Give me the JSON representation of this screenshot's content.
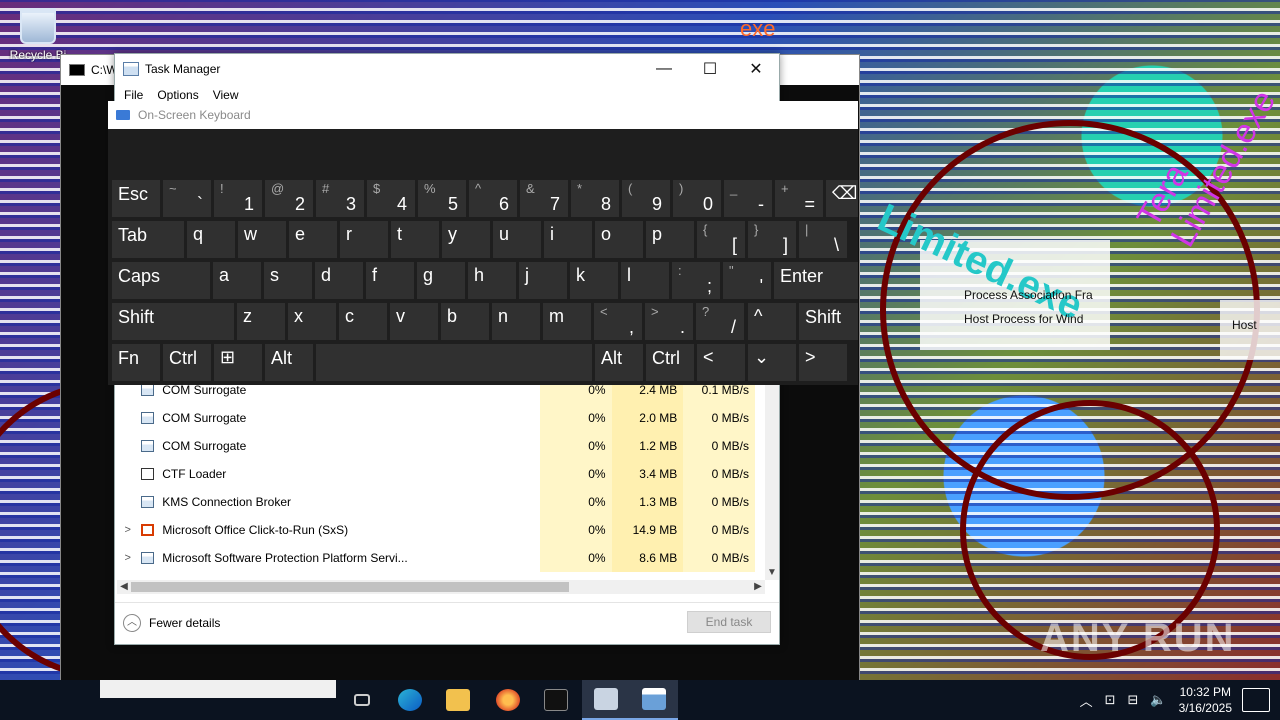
{
  "desktop": {
    "recycle_bin_label": "Recycle Bi",
    "background_texts": [
      "Tera Limited.exe",
      "exe",
      "Limited.exe",
      "Host Process for Wind",
      "Process Association Fra",
      "Host"
    ]
  },
  "terminal": {
    "title_fragment": "C:\\W",
    "partial_text": "Process for Wind"
  },
  "task_manager": {
    "title": "Task Manager",
    "menu": [
      "File",
      "Options",
      "View"
    ],
    "controls": {
      "minimize": "—",
      "maximize": "☐",
      "close": "✕"
    },
    "processes": [
      {
        "expand": "",
        "name": "COM Surrogate",
        "cpu": "0%",
        "memory": "2.4 MB",
        "disk": "0.1 MB/s"
      },
      {
        "expand": "",
        "name": "COM Surrogate",
        "cpu": "0%",
        "memory": "2.0 MB",
        "disk": "0 MB/s"
      },
      {
        "expand": "",
        "name": "COM Surrogate",
        "cpu": "0%",
        "memory": "1.2 MB",
        "disk": "0 MB/s"
      },
      {
        "expand": "",
        "name": "CTF Loader",
        "cpu": "0%",
        "memory": "3.4 MB",
        "disk": "0 MB/s"
      },
      {
        "expand": "",
        "name": "KMS Connection Broker",
        "cpu": "0%",
        "memory": "1.3 MB",
        "disk": "0 MB/s"
      },
      {
        "expand": ">",
        "name": "Microsoft Office Click-to-Run (SxS)",
        "cpu": "0%",
        "memory": "14.9 MB",
        "disk": "0 MB/s"
      },
      {
        "expand": ">",
        "name": "Microsoft Software Protection Platform Servi...",
        "cpu": "0%",
        "memory": "8.6 MB",
        "disk": "0 MB/s"
      }
    ],
    "fewer_details": "Fewer details",
    "end_task": "End task"
  },
  "osk": {
    "title": "On-Screen Keyboard",
    "keys": {
      "esc": "Esc",
      "tab": "Tab",
      "caps": "Caps",
      "shift": "Shift",
      "shift_r": "Shift",
      "enter": "Enter",
      "fn": "Fn",
      "ctrl": "Ctrl",
      "ctrl_r": "Ctrl",
      "alt": "Alt",
      "alt_r": "Alt",
      "backspace": "⌫",
      "up": "^",
      "down": "⌄",
      "left": "<",
      "right": ">",
      "win": "⊞"
    },
    "row1": [
      {
        "sym": "~",
        "chr": "`"
      },
      {
        "sym": "!",
        "chr": "1"
      },
      {
        "sym": "@",
        "chr": "2"
      },
      {
        "sym": "#",
        "chr": "3"
      },
      {
        "sym": "$",
        "chr": "4"
      },
      {
        "sym": "%",
        "chr": "5"
      },
      {
        "sym": "^",
        "chr": "6"
      },
      {
        "sym": "&",
        "chr": "7"
      },
      {
        "sym": "*",
        "chr": "8"
      },
      {
        "sym": "(",
        "chr": "9"
      },
      {
        "sym": ")",
        "chr": "0"
      },
      {
        "sym": "_",
        "chr": "-"
      },
      {
        "sym": "+",
        "chr": "="
      }
    ],
    "row2": [
      "q",
      "w",
      "e",
      "r",
      "t",
      "y",
      "u",
      "i",
      "o",
      "p"
    ],
    "row2_sym": [
      {
        "sym": "{",
        "chr": "["
      },
      {
        "sym": "}",
        "chr": "]"
      },
      {
        "sym": "|",
        "chr": "\\"
      }
    ],
    "row3": [
      "a",
      "s",
      "d",
      "f",
      "g",
      "h",
      "j",
      "k",
      "l"
    ],
    "row3_sym": [
      {
        "sym": ":",
        "chr": ";"
      },
      {
        "sym": "\"",
        "chr": "'"
      }
    ],
    "row4": [
      "z",
      "x",
      "c",
      "v",
      "b",
      "n",
      "m"
    ],
    "row4_sym": [
      {
        "sym": "<",
        "chr": ","
      },
      {
        "sym": ">",
        "chr": "."
      },
      {
        "sym": "?",
        "chr": "/"
      }
    ]
  },
  "taskbar": {
    "apps": [
      "task-view",
      "edge",
      "file-explorer",
      "firefox",
      "cmd",
      "osk",
      "task-manager"
    ],
    "time": "10:32 PM",
    "date": "3/16/2025",
    "watermark": "ANY RUN"
  }
}
